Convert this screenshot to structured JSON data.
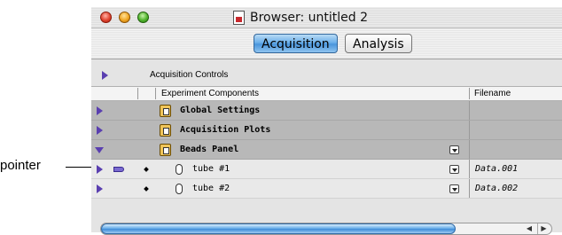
{
  "callout": {
    "label": "pointer"
  },
  "window": {
    "title": "Browser: untitled 2"
  },
  "tabs": [
    {
      "label": "Acquisition",
      "active": true
    },
    {
      "label": "Analysis",
      "active": false
    }
  ],
  "controls": {
    "label": "Acquisition Controls"
  },
  "table": {
    "columns": {
      "components": "Experiment Components",
      "filename": "Filename"
    },
    "groups": [
      {
        "label": "Global Settings",
        "expanded": false
      },
      {
        "label": "Acquisition Plots",
        "expanded": false
      },
      {
        "label": "Beads Panel",
        "expanded": true
      }
    ],
    "items": [
      {
        "label": "tube #1",
        "filename": "Data.001",
        "current": true
      },
      {
        "label": "tube #2",
        "filename": "Data.002",
        "current": false
      }
    ]
  },
  "colors": {
    "disclosure": "#5a3fb0",
    "tab_active": "#4a95dc",
    "group_row": "#b8b8b8"
  },
  "icons": [
    "close-icon",
    "minimize-icon",
    "zoom-icon",
    "document-icon",
    "disclosure-triangle-icon",
    "folder-icon",
    "tube-icon",
    "popup-menu-icon",
    "pointer-icon"
  ]
}
